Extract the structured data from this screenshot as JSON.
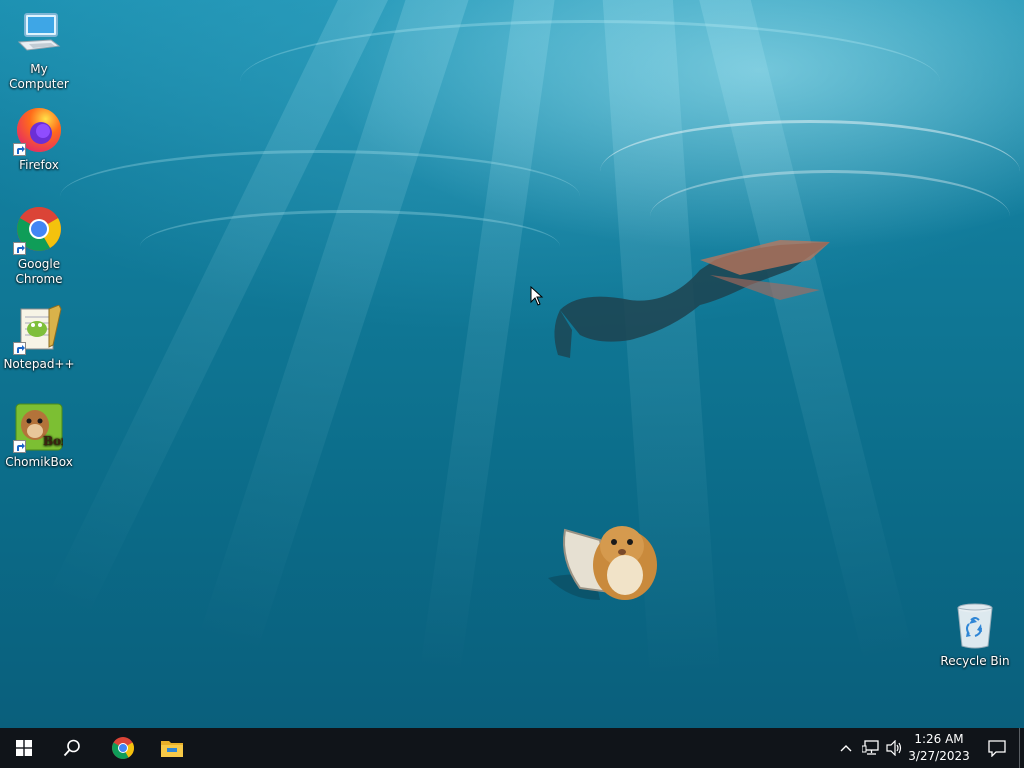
{
  "desktop": {
    "icons": [
      {
        "label": "My Computer",
        "icon": "computer-icon"
      },
      {
        "label": "Firefox",
        "icon": "firefox-icon"
      },
      {
        "label": "Google Chrome",
        "icon": "chrome-icon"
      },
      {
        "label": "Notepad++",
        "icon": "notepadpp-icon"
      },
      {
        "label": "ChomikBox",
        "icon": "chomikbox-icon"
      },
      {
        "label": "Recycle Bin",
        "icon": "recycle-bin-icon"
      }
    ]
  },
  "taskbar": {
    "start": {
      "icon": "windows-logo-icon"
    },
    "search": {
      "icon": "search-icon"
    },
    "pinned": [
      {
        "icon": "chrome-icon"
      },
      {
        "icon": "file-explorer-icon"
      }
    ],
    "tray": {
      "icons": [
        "chevron-up-icon",
        "network-icon",
        "volume-icon"
      ],
      "time": "1:26 AM",
      "date": "3/27/2023",
      "notification_icon": "action-center-icon"
    }
  },
  "colors": {
    "taskbar": "#101419",
    "water": "#0f7694"
  }
}
